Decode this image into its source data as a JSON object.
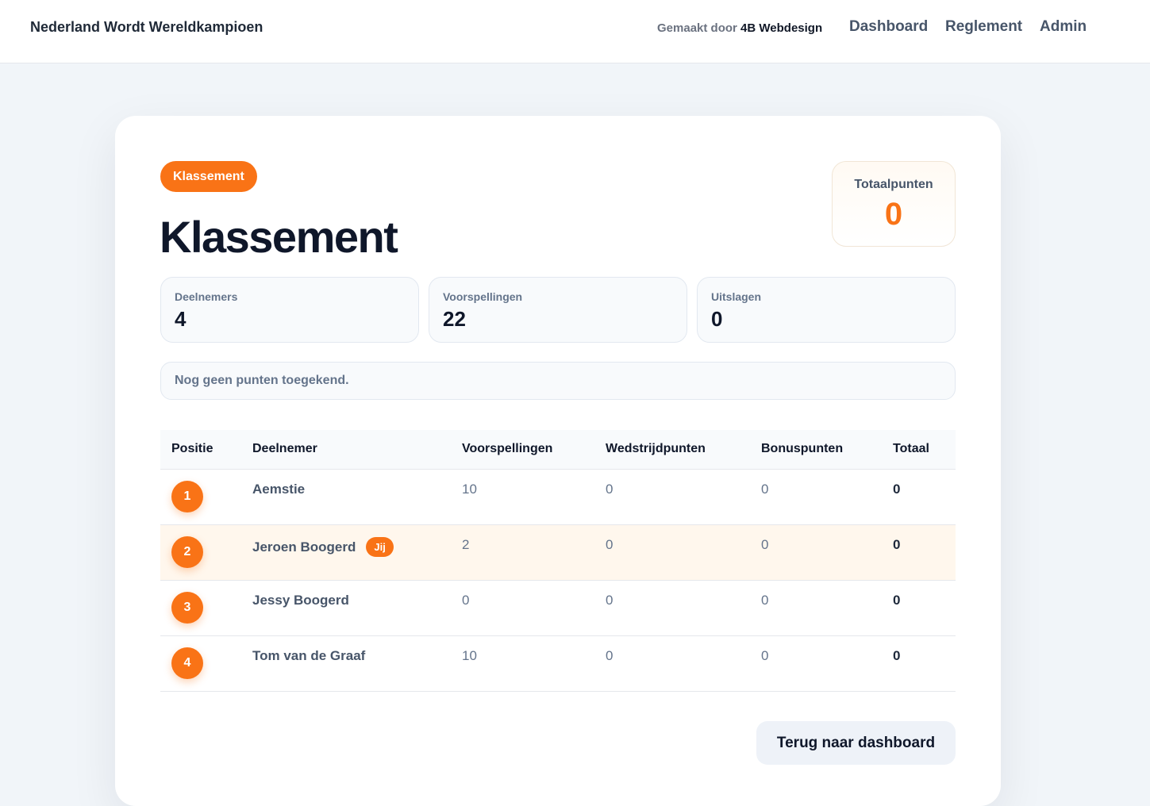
{
  "header": {
    "brand": "Nederland Wordt Wereldkampioen",
    "credit_prefix": "Gemaakt door",
    "credit_name": "4B Webdesign",
    "nav": {
      "dashboard": "Dashboard",
      "reglement": "Reglement",
      "admin": "Admin"
    }
  },
  "page": {
    "pill": "Klassement",
    "title": "Klassement",
    "total_points": {
      "label": "Totaalpunten",
      "value": "0"
    },
    "stats": {
      "participants": {
        "label": "Deelnemers",
        "value": "4"
      },
      "predictions": {
        "label": "Voorspellingen",
        "value": "22"
      },
      "results": {
        "label": "Uitslagen",
        "value": "0"
      }
    },
    "notice": "Nog geen punten toegekend."
  },
  "table": {
    "headers": [
      "Positie",
      "Deelnemer",
      "Voorspellingen",
      "Wedstrijdpunten",
      "Bonuspunten",
      "Totaal"
    ],
    "you_badge": "Jij",
    "rows": [
      {
        "position": "1",
        "name": "Aemstie",
        "predictions": "10",
        "match_points": "0",
        "bonus_points": "0",
        "total": "0"
      },
      {
        "position": "2",
        "name": "Jeroen Boogerd",
        "predictions": "2",
        "match_points": "0",
        "bonus_points": "0",
        "total": "0"
      },
      {
        "position": "3",
        "name": "Jessy Boogerd",
        "predictions": "0",
        "match_points": "0",
        "bonus_points": "0",
        "total": "0"
      },
      {
        "position": "4",
        "name": "Tom van de Graaf",
        "predictions": "10",
        "match_points": "0",
        "bonus_points": "0",
        "total": "0"
      }
    ]
  },
  "footer": {
    "back_button": "Terug naar dashboard"
  },
  "colors": {
    "accent": "#f97316",
    "highlight_row": "#fff7ed",
    "background": "#f1f5f9"
  }
}
